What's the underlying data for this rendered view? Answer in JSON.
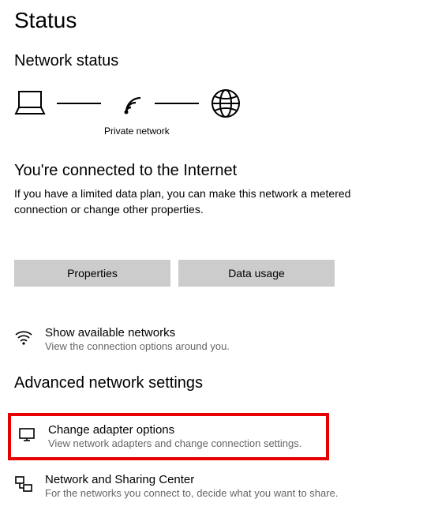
{
  "header": {
    "title": "Status",
    "section_title": "Network status"
  },
  "diagram": {
    "caption": "Private network"
  },
  "status": {
    "heading": "You're connected to the Internet",
    "description": "If you have a limited data plan, you can make this network a metered connection or change other properties."
  },
  "buttons": {
    "properties": "Properties",
    "data_usage": "Data usage"
  },
  "items": {
    "show_networks": {
      "title": "Show available networks",
      "sub": "View the connection options around you."
    },
    "adapter": {
      "title": "Change adapter options",
      "sub": "View network adapters and change connection settings."
    },
    "sharing": {
      "title": "Network and Sharing Center",
      "sub": "For the networks you connect to, decide what you want to share."
    }
  },
  "sections": {
    "advanced": "Advanced network settings"
  }
}
